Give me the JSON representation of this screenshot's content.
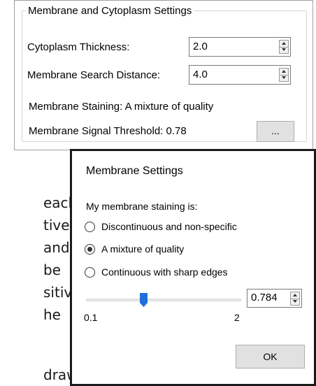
{
  "panel": {
    "title": "Membrane and Cytoplasm Settings",
    "cytoplasm_thickness": {
      "label": "Cytoplasm Thickness:",
      "value": "2.0"
    },
    "membrane_search_distance": {
      "label": "Membrane Search Distance:",
      "value": "4.0"
    },
    "membrane_staining": "Membrane Staining: A mixture of quality",
    "membrane_signal_threshold": "Membrane Signal Threshold: 0.78",
    "ellipsis_label": "..."
  },
  "background_text": {
    "lines": [
      "each",
      "tive",
      "and",
      "be",
      "sitive",
      "he",
      "drawn"
    ]
  },
  "dialog": {
    "title": "Membrane Settings",
    "prompt": "My membrane staining is:",
    "options": [
      {
        "label": "Discontinuous and non-specific",
        "checked": false
      },
      {
        "label": "A mixture of quality",
        "checked": true
      },
      {
        "label": "Continuous with sharp edges",
        "checked": false
      }
    ],
    "slider": {
      "min_label": "0.1",
      "max_label": "2",
      "min": 0.1,
      "max": 2,
      "value": 0.784
    },
    "value_box": "0.784",
    "ok_label": "OK"
  },
  "colors": {
    "slider_thumb": "#1e6fd9"
  }
}
